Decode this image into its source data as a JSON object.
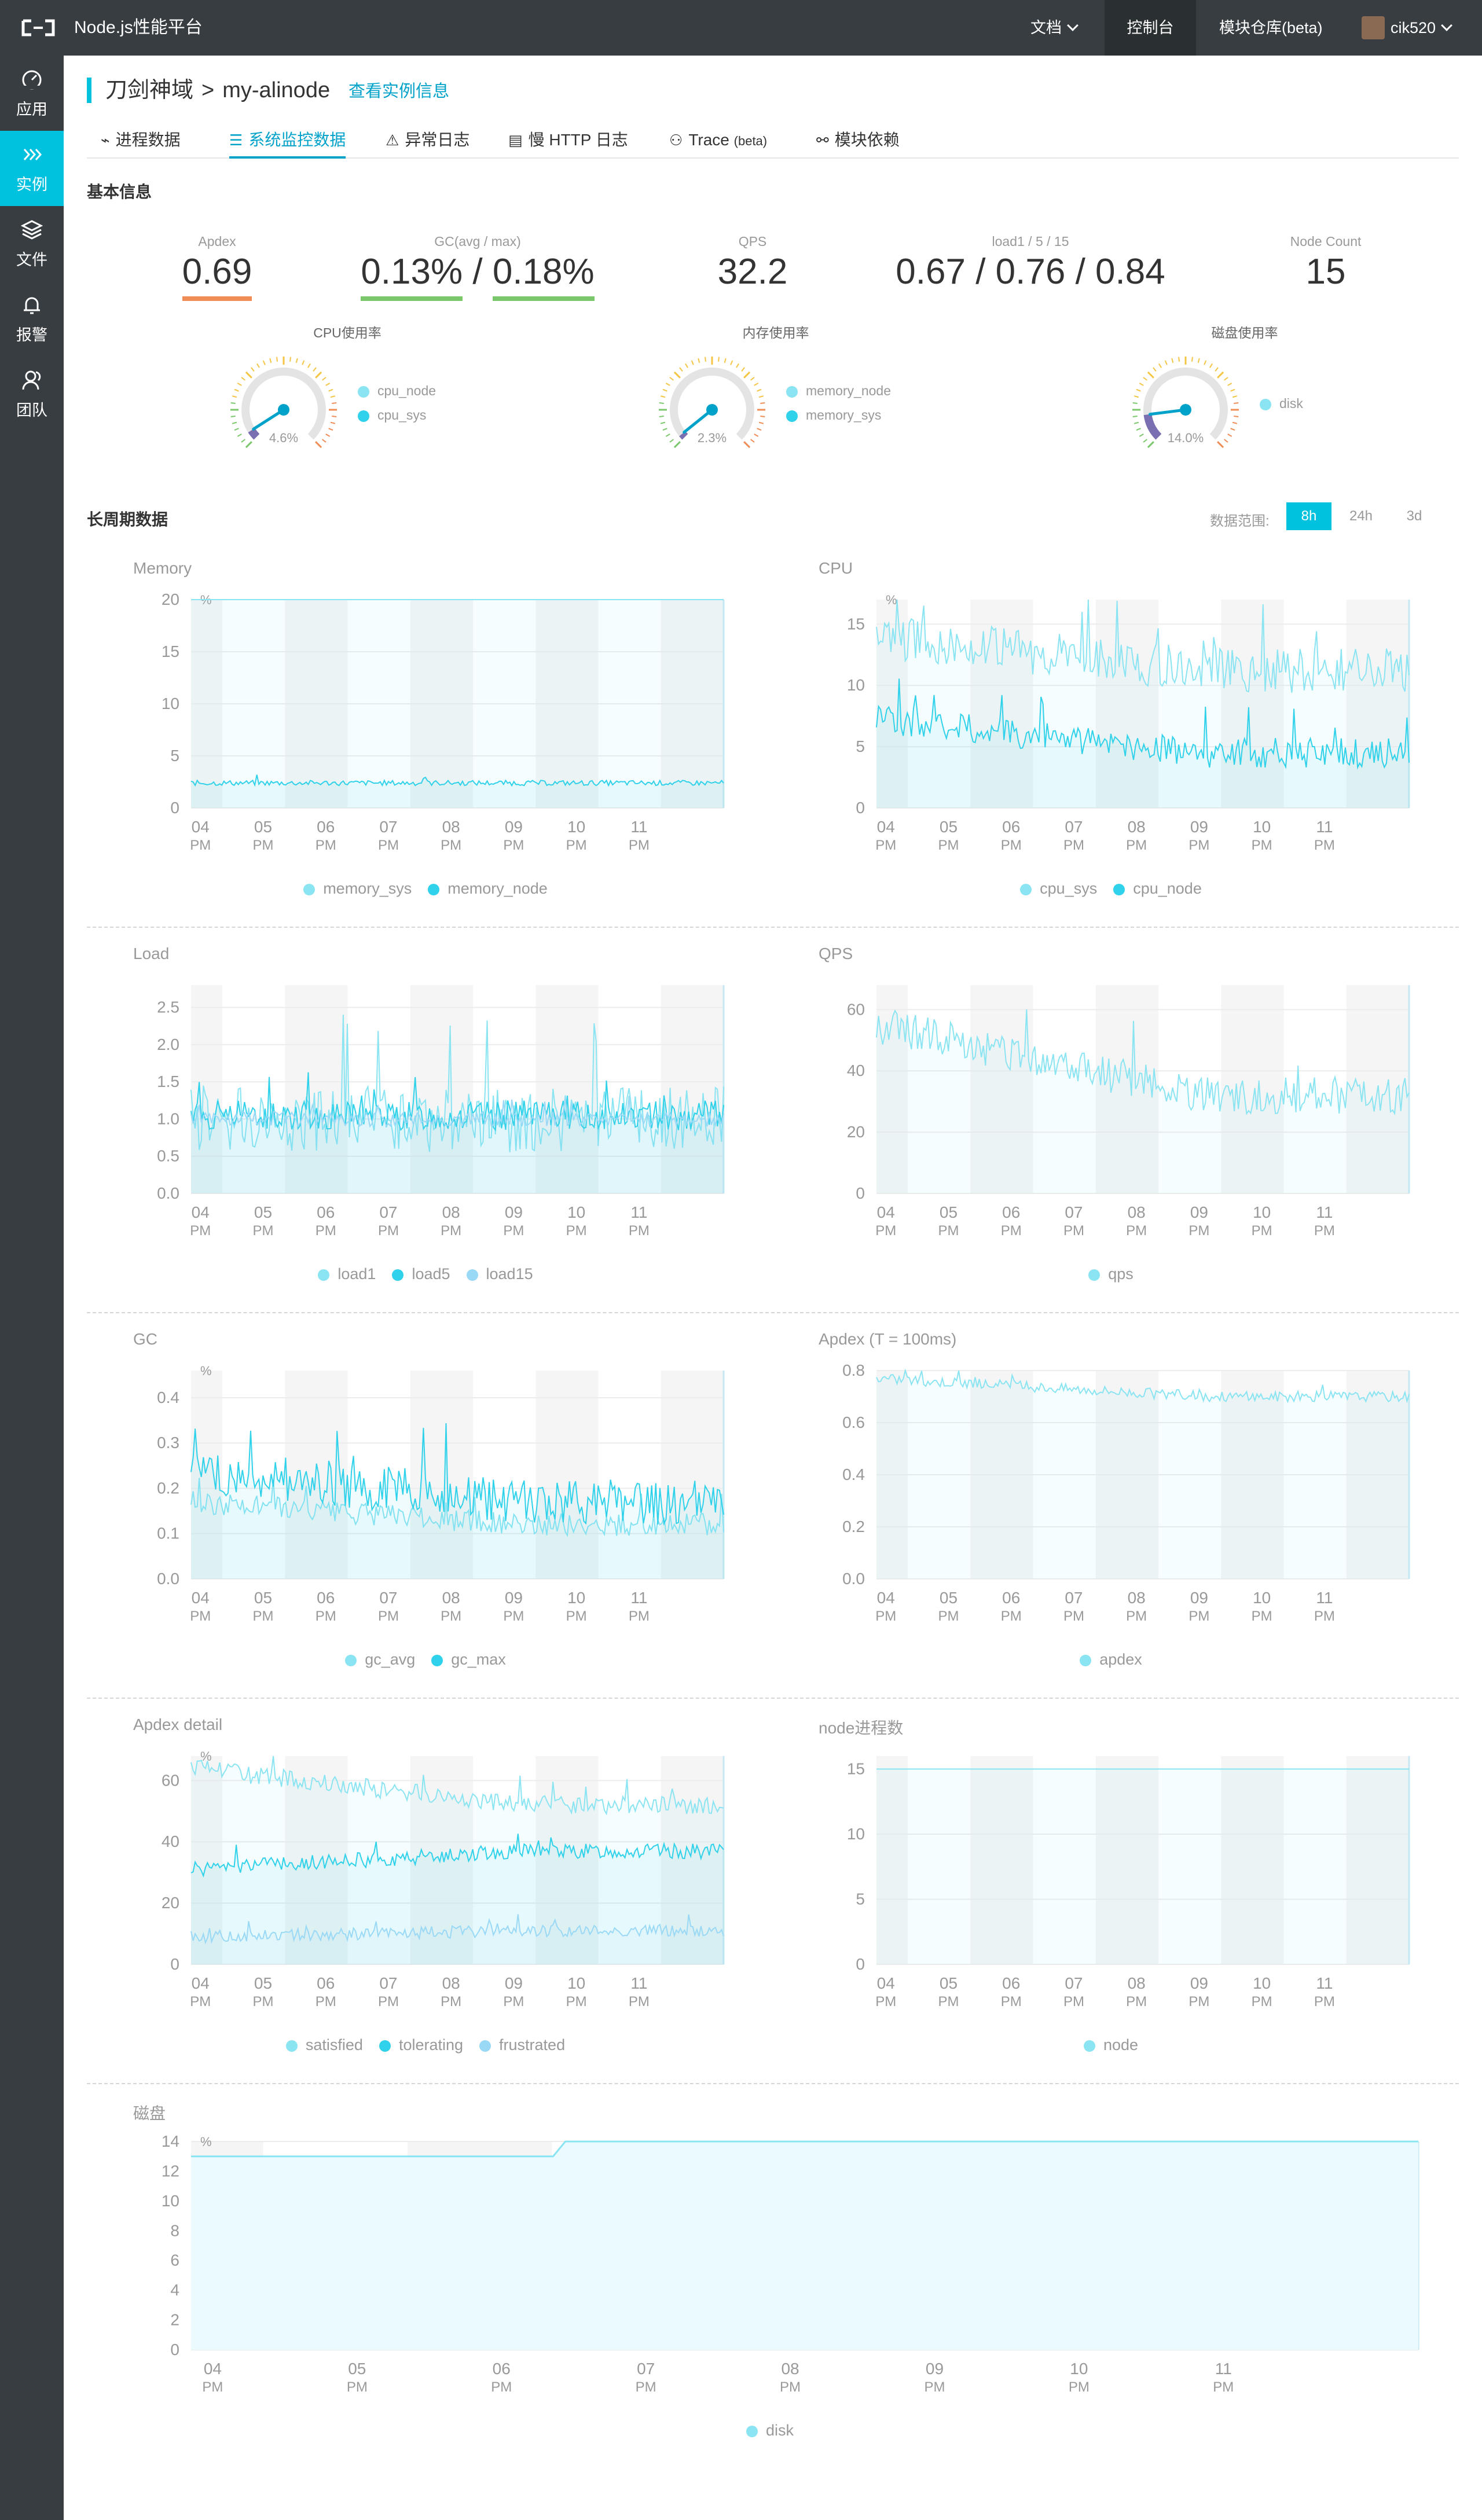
{
  "topbar": {
    "brand": "Node.js性能平台",
    "docs": "文档",
    "console": "控制台",
    "module_repo": "模块仓库(beta)",
    "user": "cik520"
  },
  "sidebar": {
    "items": [
      {
        "label": "应用",
        "icon": "dashboard-icon"
      },
      {
        "label": "实例",
        "icon": "chevrons-right-icon"
      },
      {
        "label": "文件",
        "icon": "layers-icon"
      },
      {
        "label": "报警",
        "icon": "bell-icon"
      },
      {
        "label": "团队",
        "icon": "team-icon"
      }
    ]
  },
  "breadcrumb": {
    "app": "刀剑神域",
    "separator": ">",
    "instance": "my-alinode",
    "view_link": "查看实例信息"
  },
  "tabs": [
    {
      "label": "进程数据",
      "icon": "pulse-icon"
    },
    {
      "label": "系统监控数据",
      "icon": "list-icon"
    },
    {
      "label": "异常日志",
      "icon": "warning-icon"
    },
    {
      "label": "慢 HTTP 日志",
      "icon": "doc-icon"
    },
    {
      "label": "Trace",
      "suffix": "(beta)",
      "icon": "trace-icon"
    },
    {
      "label": "模块依赖",
      "icon": "share-icon"
    }
  ],
  "basic": {
    "title": "基本信息",
    "apdex": {
      "label": "Apdex",
      "value": "0.69",
      "color": "#f08c55"
    },
    "gc": {
      "label": "GC(avg / max)",
      "avg": "0.13%",
      "max": "0.18%",
      "sep": "/",
      "color": "#7bc86c"
    },
    "qps": {
      "label": "QPS",
      "value": "32.2"
    },
    "load": {
      "label": "load1 / 5 / 15",
      "l1": "0.67",
      "l5": "0.76",
      "l15": "0.84",
      "sep": "/"
    },
    "node_count": {
      "label": "Node Count",
      "value": "15"
    }
  },
  "gauges": [
    {
      "title": "CPU使用率",
      "value": 4.6,
      "display": "4.6%",
      "legend": [
        "cpu_node",
        "cpu_sys"
      ]
    },
    {
      "title": "内存使用率",
      "value": 2.3,
      "display": "2.3%",
      "legend": [
        "memory_node",
        "memory_sys"
      ]
    },
    {
      "title": "磁盘使用率",
      "value": 14.0,
      "display": "14.0%",
      "legend": [
        "disk"
      ]
    }
  ],
  "long": {
    "title": "长周期数据",
    "range_label": "数据范围:",
    "ranges": [
      "8h",
      "24h",
      "3d"
    ],
    "active_range": "8h"
  },
  "x_ticks": [
    "04",
    "05",
    "06",
    "07",
    "08",
    "09",
    "10",
    "11"
  ],
  "x_tick_sub": "PM",
  "colors": {
    "light": "#8ae4f2",
    "mid": "#2fd2ea",
    "pale": "#9ad9f6",
    "accent": "#00c1de"
  },
  "chart_data": [
    {
      "title": "Memory",
      "type": "line",
      "unit": "%",
      "ylim": [
        0,
        20
      ],
      "yticks": [
        0,
        5,
        10,
        15,
        20
      ],
      "series": [
        {
          "name": "memory_sys",
          "level": 20.2,
          "noise": 0.2,
          "trend": 0.1
        },
        {
          "name": "memory_node",
          "level": 2.4,
          "noise": 0.25,
          "trend": 0
        }
      ]
    },
    {
      "title": "CPU",
      "type": "line",
      "unit": "%",
      "ylim": [
        0,
        17
      ],
      "yticks": [
        0,
        5,
        10,
        15
      ],
      "series": [
        {
          "name": "cpu_sys",
          "level": 14,
          "end": 11.2,
          "noise": 1.8
        },
        {
          "name": "cpu_node",
          "level": 7.2,
          "end": 4.5,
          "noise": 1.2
        }
      ]
    },
    {
      "title": "Load",
      "type": "line",
      "unit": "",
      "ylim": [
        0,
        2.8
      ],
      "yticks": [
        0.0,
        0.5,
        1.0,
        1.5,
        2.0,
        2.5
      ],
      "series": [
        {
          "name": "load1",
          "level": 1.0,
          "noise": 0.45
        },
        {
          "name": "load5",
          "level": 1.05,
          "noise": 0.2
        },
        {
          "name": "load15",
          "level": 1.0,
          "noise": 0.1
        }
      ]
    },
    {
      "title": "QPS",
      "type": "line",
      "unit": "",
      "ylim": [
        0,
        68
      ],
      "yticks": [
        0,
        20,
        40,
        60
      ],
      "series": [
        {
          "name": "qps",
          "level": 55,
          "end": 32,
          "noise": 6
        }
      ]
    },
    {
      "title": "GC",
      "type": "line",
      "unit": "%",
      "ylim": [
        0,
        0.46
      ],
      "yticks": [
        0.0,
        0.1,
        0.2,
        0.3,
        0.4
      ],
      "series": [
        {
          "name": "gc_avg",
          "level": 0.17,
          "end": 0.12,
          "noise": 0.025
        },
        {
          "name": "gc_max",
          "level": 0.24,
          "end": 0.17,
          "noise": 0.05
        }
      ]
    },
    {
      "title": "Apdex (T = 100ms)",
      "type": "line",
      "unit": "",
      "ylim": [
        0,
        0.8
      ],
      "yticks": [
        0.0,
        0.2,
        0.4,
        0.6,
        0.8
      ],
      "series": [
        {
          "name": "apdex",
          "level": 0.77,
          "end": 0.7,
          "noise": 0.02
        }
      ]
    },
    {
      "title": "Apdex detail",
      "type": "line",
      "unit": "%",
      "ylim": [
        0,
        68
      ],
      "yticks": [
        0,
        20,
        40,
        60
      ],
      "series": [
        {
          "name": "satisfied",
          "level": 64,
          "end": 52,
          "noise": 3
        },
        {
          "name": "tolerating",
          "level": 31,
          "end": 37,
          "noise": 2.5
        },
        {
          "name": "frustrated",
          "level": 9,
          "end": 11,
          "noise": 2
        }
      ]
    },
    {
      "title": "node进程数",
      "type": "line",
      "unit": "",
      "ylim": [
        0,
        16
      ],
      "yticks": [
        0,
        5,
        10,
        15
      ],
      "series": [
        {
          "name": "node",
          "level": 15,
          "end": 15,
          "noise": 0
        }
      ]
    },
    {
      "title": "磁盘",
      "type": "area",
      "unit": "%",
      "ylim": [
        0,
        14
      ],
      "yticks": [
        0,
        2,
        4,
        6,
        8,
        10,
        12,
        14
      ],
      "series": [
        {
          "name": "disk",
          "level": 13,
          "end": 14,
          "noise": 0
        }
      ]
    }
  ]
}
